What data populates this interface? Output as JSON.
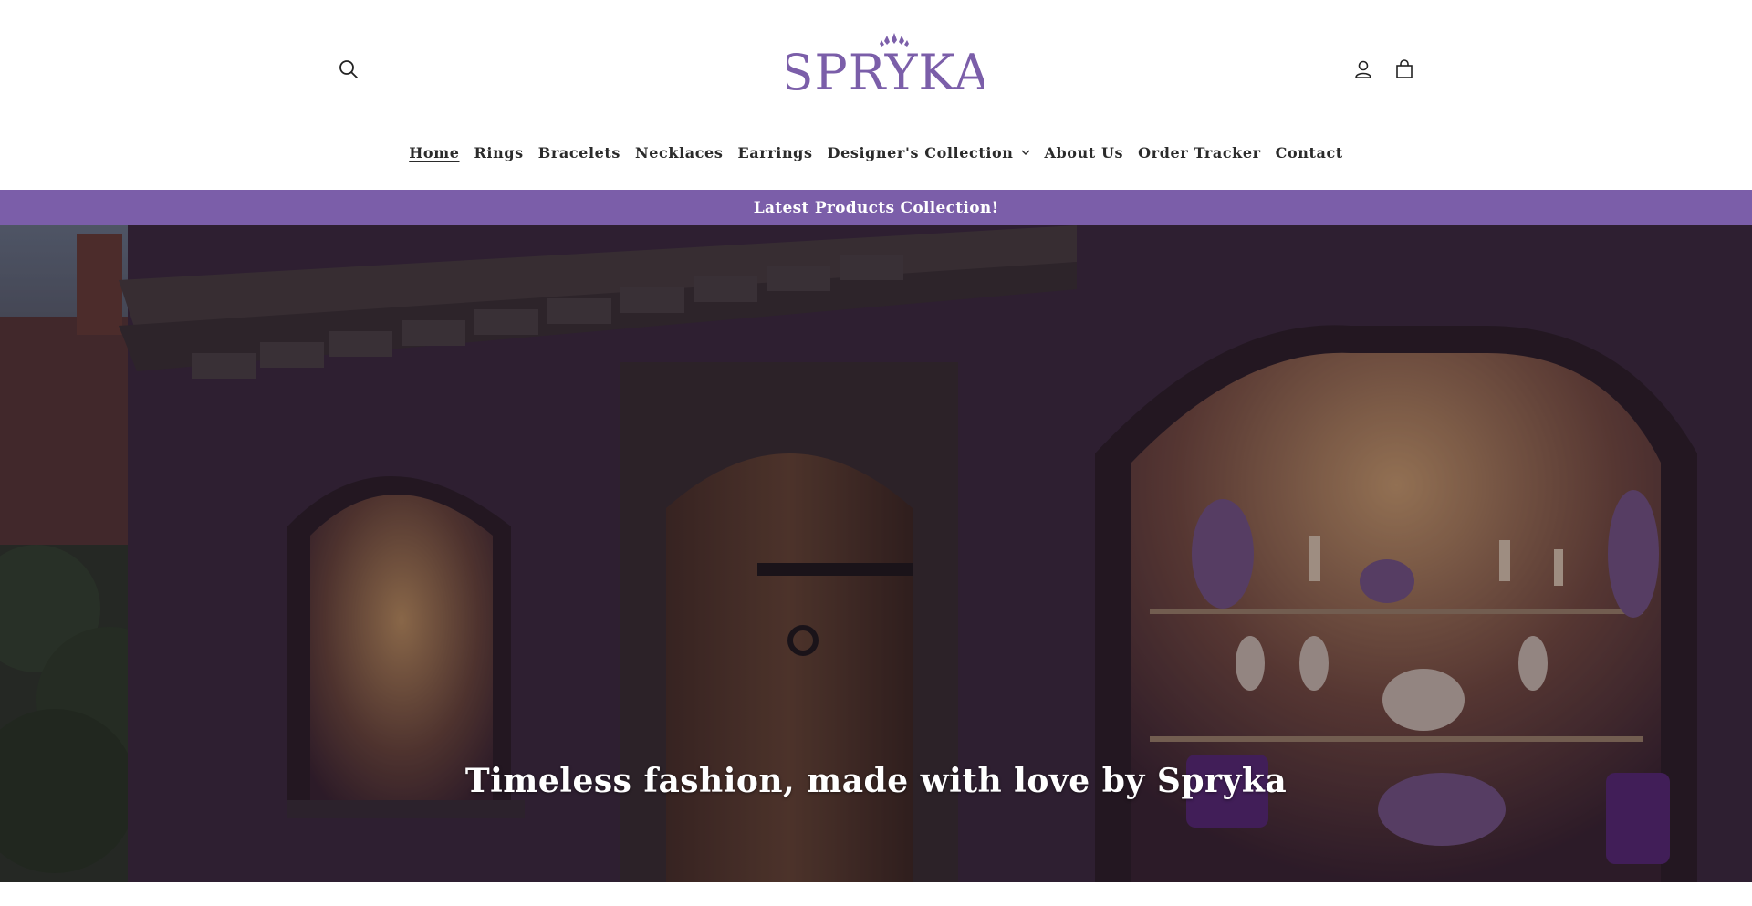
{
  "header": {
    "search_icon": "search-icon",
    "account_icon": "account-icon",
    "cart_icon": "cart-icon",
    "logo_text": "SPRYKA",
    "brand_color": "#7b5ea9"
  },
  "nav": {
    "items": [
      {
        "label": "Home",
        "active": true
      },
      {
        "label": "Rings"
      },
      {
        "label": "Bracelets"
      },
      {
        "label": "Necklaces"
      },
      {
        "label": "Earrings"
      },
      {
        "label": "Designer's Collection",
        "has_dropdown": true
      },
      {
        "label": "About Us"
      },
      {
        "label": "Order Tracker"
      },
      {
        "label": "Contact"
      }
    ]
  },
  "announcement": {
    "text": "Latest Products Collection!",
    "background": "#7b5ea9"
  },
  "hero": {
    "title": "Timeless fashion, made with love by Spryka"
  }
}
